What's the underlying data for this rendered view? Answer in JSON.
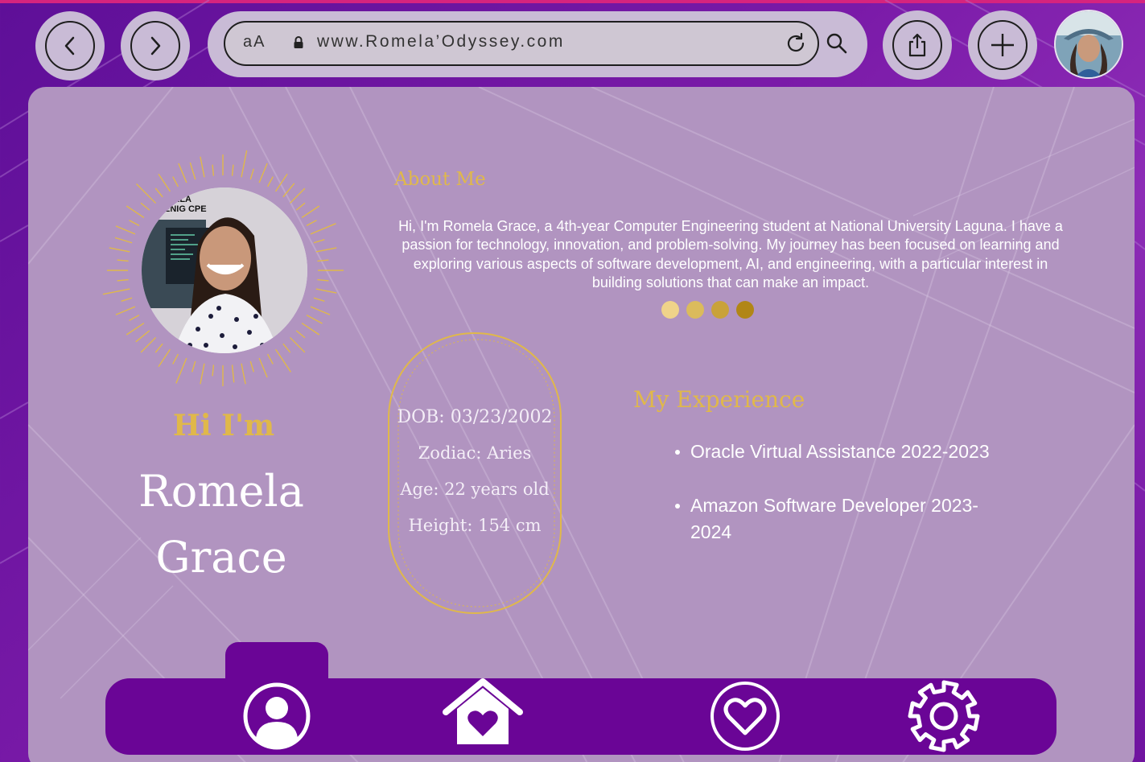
{
  "browser": {
    "back_icon": "chevron-left-icon",
    "forward_icon": "chevron-right-icon",
    "text_size_label": "aA",
    "url": "www.Romela’Odyssey.com",
    "reload_icon": "reload-icon",
    "search_icon": "search-icon",
    "share_icon": "share-icon",
    "new_tab_icon": "plus-icon",
    "avatar_icon": "profile-avatar"
  },
  "profile": {
    "greeting": "Hi I'm",
    "first_name": "Romela",
    "last_name": "Grace",
    "photo": "profile-photo"
  },
  "about": {
    "title": "About Me",
    "text": "Hi, I'm Romela Grace, a 4th-year Computer Engineering student at National University Laguna. I have a passion for technology, innovation, and problem-solving. My journey has been focused on learning and exploring various aspects of software development, AI, and engineering, with a particular interest in building solutions that can make an impact.",
    "dot_colors": [
      "#efd38a",
      "#dbbb5c",
      "#c9a23a",
      "#b18616"
    ]
  },
  "details": {
    "dob": "DOB: 03/23/2002",
    "zodiac": "Zodiac: Aries",
    "age": "Age: 22 years old",
    "height": "Height: 154 cm"
  },
  "experience": {
    "title": "My Experience",
    "items": [
      "Oracle Virtual Assistance 2022-2023",
      "Amazon Software Developer 2023-2024"
    ]
  },
  "nav": {
    "items": [
      "profile-icon",
      "home-heart-icon",
      "heart-icon",
      "gear-icon"
    ]
  },
  "colors": {
    "accent_gold": "#e0b84a",
    "nav_purple": "#6a0596",
    "panel": "#b194c0"
  }
}
